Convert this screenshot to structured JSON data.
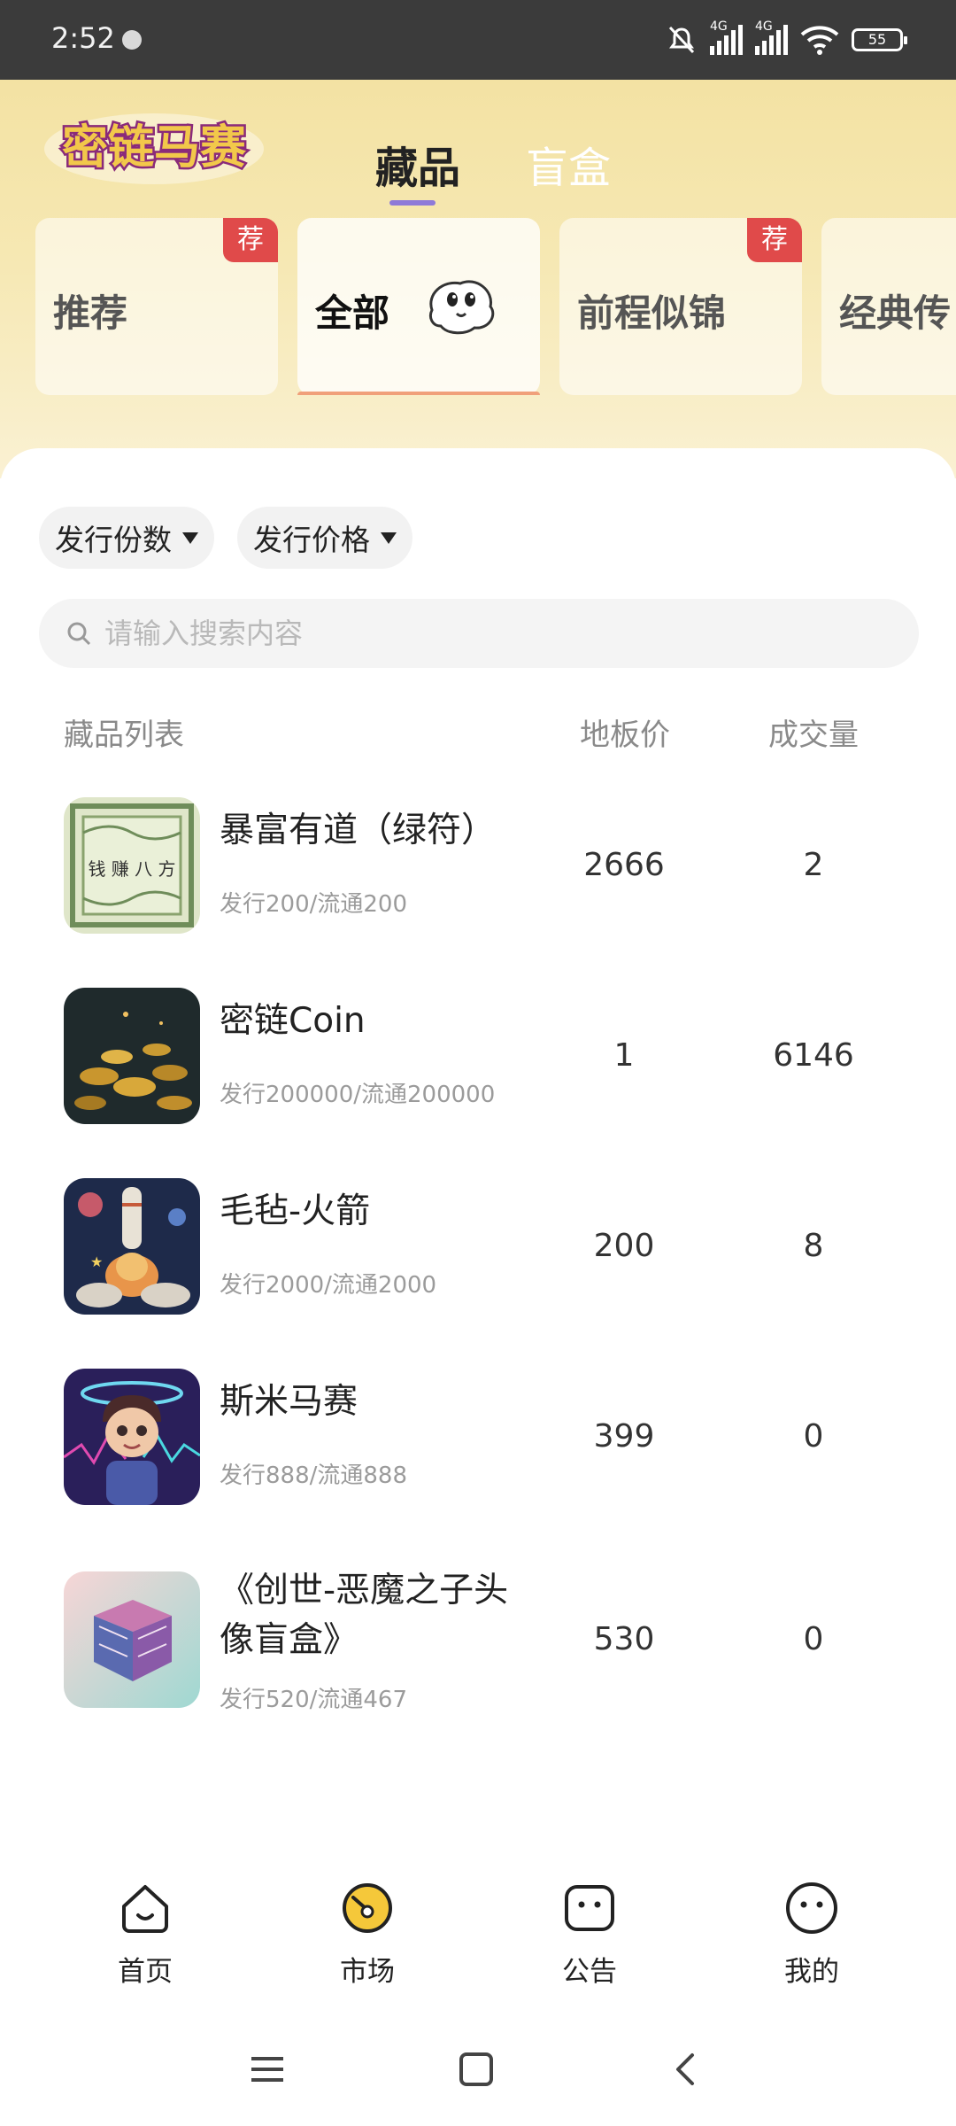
{
  "status_bar": {
    "time": "2:52",
    "network_1": "4G",
    "network_2": "4G",
    "battery": "55"
  },
  "header": {
    "logo_text": "密链马赛",
    "tabs": [
      {
        "label": "藏品"
      },
      {
        "label": "盲盒"
      }
    ],
    "active_tab": "藏品"
  },
  "categories": [
    {
      "label": "推荐",
      "badge": "荐"
    },
    {
      "label": "全部",
      "badge": ""
    },
    {
      "label": "前程似锦",
      "badge": "荐"
    },
    {
      "label": "经典传",
      "badge": ""
    }
  ],
  "filters": [
    {
      "label": "发行份数"
    },
    {
      "label": "发行价格"
    }
  ],
  "search": {
    "placeholder": "请输入搜索内容"
  },
  "list_header": {
    "name": "藏品列表",
    "floor_price": "地板价",
    "volume": "成交量"
  },
  "items": [
    {
      "name": "暴富有道（绿符）",
      "sub": "发行200/流通200",
      "price": "2666",
      "volume": "2",
      "thumb_text": "钱 赚 八 方"
    },
    {
      "name": "密链Coin",
      "sub": "发行200000/流通200000",
      "price": "1",
      "volume": "6146"
    },
    {
      "name": "毛毡-火箭",
      "sub": "发行2000/流通2000",
      "price": "200",
      "volume": "8"
    },
    {
      "name": "斯米马赛",
      "sub": "发行888/流通888",
      "price": "399",
      "volume": "0"
    },
    {
      "name": "《创世-恶魔之子头像盲盒》",
      "sub": "发行520/流通467",
      "price": "530",
      "volume": "0"
    }
  ],
  "bottom_nav": [
    {
      "label": "首页",
      "icon": "home-face-icon"
    },
    {
      "label": "市场",
      "icon": "market-icon",
      "active": true
    },
    {
      "label": "公告",
      "icon": "notice-icon"
    },
    {
      "label": "我的",
      "icon": "profile-icon"
    }
  ],
  "colors": {
    "accent_purple": "#8e7ad8",
    "badge_red": "#e04a4a",
    "tab_underline_orange": "#f0a07a"
  }
}
